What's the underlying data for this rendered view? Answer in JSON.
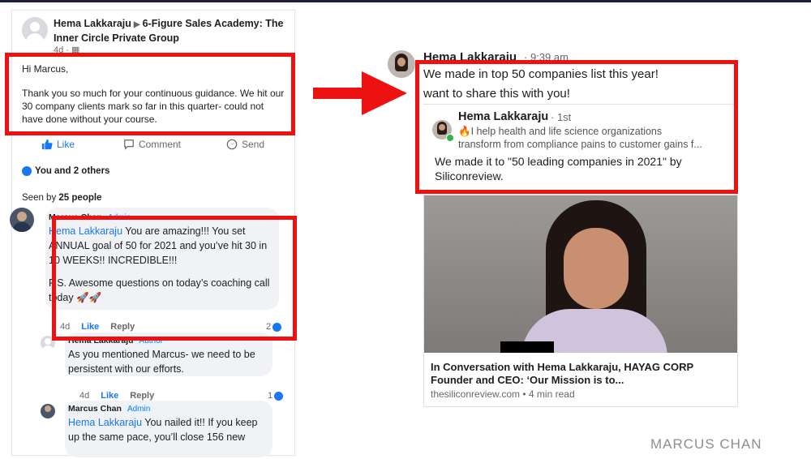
{
  "facebook": {
    "author": "Hema Lakkaraju",
    "group": "6-Figure Sales Academy: The Inner Circle Private Group",
    "time": "4d",
    "greeting": "Hi Marcus,",
    "body": "Thank you so much for your continuous guidance. We hit our 30 company clients  mark  so far in this quarter- could not have done without your course.",
    "actions": {
      "like": "Like",
      "comment": "Comment",
      "send": "Send"
    },
    "reactions": "You and 2 others",
    "seen_prefix": "Seen by",
    "seen_count": "25 people",
    "comments": [
      {
        "name": "Marcus Chan",
        "badge": "Admin",
        "tag": "Hema Lakkaraju",
        "text": " You are amazing!!! You set ANNUAL goal of 50 for 2021 and you’ve hit 30 in 10 WEEKS!! INCREDIBLE!!!",
        "text2": "P.S. Awesome questions on today’s coaching call today 🚀🚀",
        "time": "4d",
        "like": "Like",
        "reply": "Reply",
        "count": "2"
      },
      {
        "name": "Hema Lakkaraju",
        "badge": "Author",
        "text": "As you mentioned Marcus- we need to be persistent with our efforts.",
        "time": "4d",
        "like": "Like",
        "reply": "Reply",
        "count": "1"
      },
      {
        "name": "Marcus Chan",
        "badge": "Admin",
        "tag": "Hema Lakkaraju",
        "text": " You nailed it!! If you keep up the same pace, you’ll close 156 new"
      }
    ]
  },
  "linkedin": {
    "name": "Hema Lakkaraju",
    "time": "9:39 am",
    "message_line1": "We made in top 50 companies list this year!",
    "message_line2": "want to share this with you!",
    "shared": {
      "name": "Hema Lakkaraju",
      "degree": "1st",
      "headline_line1": "🔥I help health and life science organizations",
      "headline_line2": "transform from compliance pains to customer gains f...",
      "post": "We made it to \"50 leading companies in 2021\" by Siliconreview."
    },
    "article": {
      "title": "In Conversation with Hema Lakkaraju, HAYAG CORP Founder and CEO: ‘Our Mission is to...",
      "source": "thesiliconreview.com",
      "read_time": "4 min read"
    }
  },
  "watermark": "MARCUS CHAN",
  "colors": {
    "highlight": "#ee1111",
    "fb_blue": "#1877f2"
  }
}
